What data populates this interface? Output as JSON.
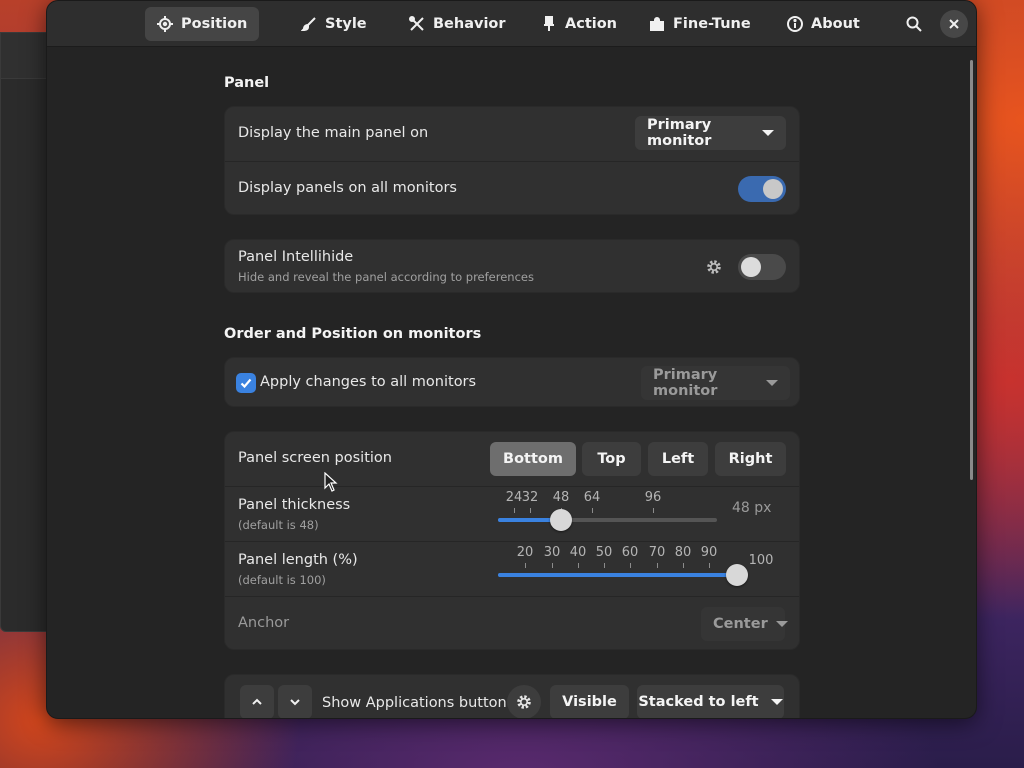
{
  "tabs": [
    {
      "label": "Position",
      "icon": "crosshair-icon"
    },
    {
      "label": "Style",
      "icon": "paintbrush-icon"
    },
    {
      "label": "Behavior",
      "icon": "tools-icon"
    },
    {
      "label": "Action",
      "icon": "pin-icon"
    },
    {
      "label": "Fine-Tune",
      "icon": "puzzle-icon"
    },
    {
      "label": "About",
      "icon": "info-icon"
    }
  ],
  "active_tab": "Position",
  "header_icons": {
    "search": "search-icon",
    "close": "close-icon"
  },
  "panel": {
    "title": "Panel",
    "main_panel_label": "Display the main panel on",
    "main_panel_value": "Primary monitor",
    "all_monitors_label": "Display panels on all monitors",
    "all_monitors_on": true
  },
  "intellihide": {
    "label": "Panel Intellihide",
    "sub": "Hide and reveal the panel according to preferences",
    "enabled": false
  },
  "order": {
    "title": "Order and Position on monitors",
    "apply_label": "Apply changes to all monitors",
    "apply_checked": true,
    "monitor_value": "Primary monitor"
  },
  "screen_position": {
    "label": "Panel screen position",
    "options": [
      "Bottom",
      "Top",
      "Left",
      "Right"
    ],
    "selected": "Bottom"
  },
  "thickness": {
    "label": "Panel thickness",
    "sub": "(default is 48)",
    "marks": [
      "24",
      "32",
      "48",
      "64",
      "96"
    ],
    "value": 48,
    "value_text": "48 px"
  },
  "length": {
    "label": "Panel length (%)",
    "sub": "(default is 100)",
    "marks": [
      "20",
      "30",
      "40",
      "50",
      "60",
      "70",
      "80",
      "90",
      "100"
    ],
    "value": 100
  },
  "anchor": {
    "label": "Anchor",
    "value": "Center"
  },
  "apps_button": {
    "label": "Show Applications button",
    "visible_label": "Visible",
    "position_value": "Stacked to left"
  },
  "colors": {
    "accent": "#3a82e0",
    "switch_on": "#3a6ab0",
    "window_bg": "#242424",
    "card_bg": "#303030"
  }
}
